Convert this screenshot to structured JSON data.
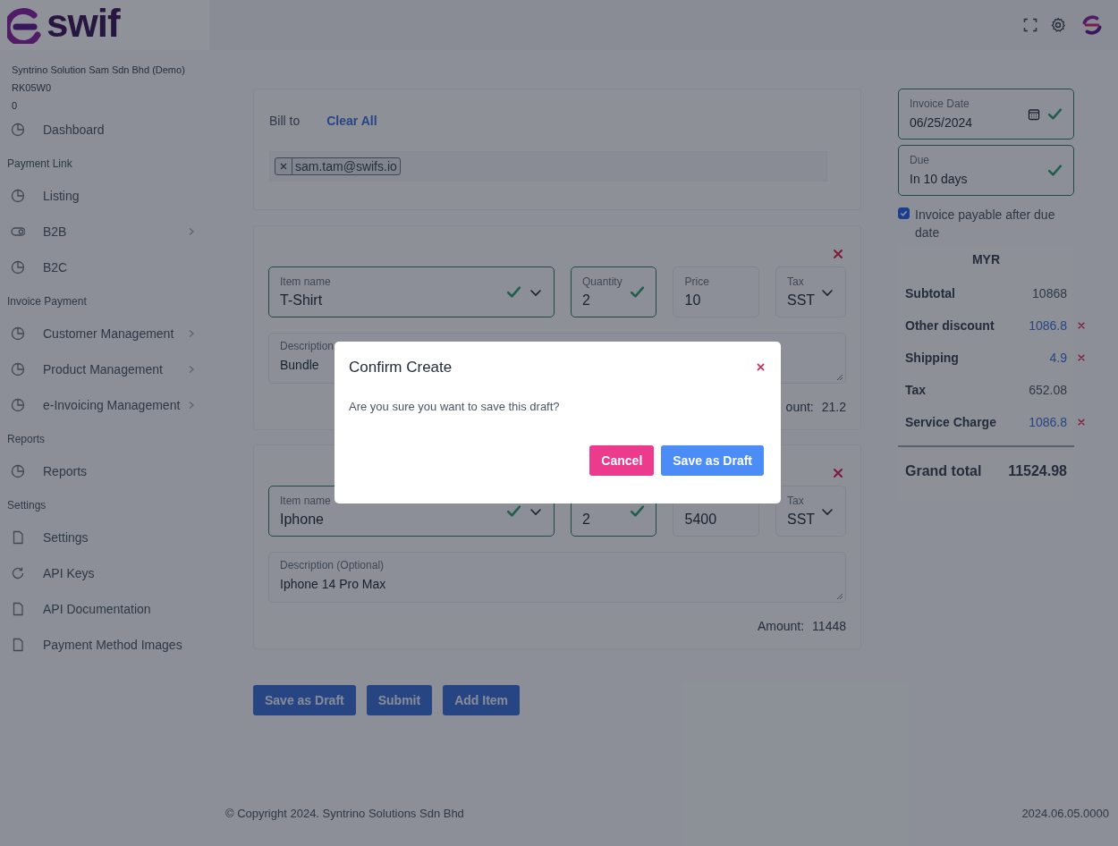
{
  "logo": {
    "text": "swif"
  },
  "account": {
    "company": "Syntrino Solution Sam Sdn Bhd (Demo)",
    "code": "RK05W0",
    "balance": "0"
  },
  "sidebar": {
    "items": [
      {
        "kind": "pie",
        "label": "Dashboard",
        "expandable": false
      },
      {
        "kind": "heading",
        "label": "Payment Link"
      },
      {
        "kind": "pie",
        "label": "Listing",
        "expandable": false
      },
      {
        "kind": "toggle",
        "label": "B2B",
        "expandable": true
      },
      {
        "kind": "pie",
        "label": "B2C",
        "expandable": false
      },
      {
        "kind": "heading",
        "label": "Invoice Payment"
      },
      {
        "kind": "pie",
        "label": "Customer Management",
        "expandable": true
      },
      {
        "kind": "pie",
        "label": "Product Management",
        "expandable": true
      },
      {
        "kind": "pie",
        "label": "e-Invoicing Management",
        "expandable": true
      },
      {
        "kind": "heading",
        "label": "Reports"
      },
      {
        "kind": "pie",
        "label": "Reports",
        "expandable": false
      },
      {
        "kind": "heading",
        "label": "Settings"
      },
      {
        "kind": "file",
        "label": "Settings",
        "expandable": false
      },
      {
        "kind": "refresh",
        "label": "API Keys",
        "expandable": false
      },
      {
        "kind": "file",
        "label": "API Documentation",
        "expandable": false
      },
      {
        "kind": "file",
        "label": "Payment Method Images",
        "expandable": false
      }
    ]
  },
  "bill_to": {
    "label": "Bill to",
    "clear_link": "Clear All",
    "recipients": [
      "sam.tam@swifs.io"
    ]
  },
  "items": [
    {
      "name": {
        "label": "Item name",
        "value": "T-Shirt",
        "valid": true
      },
      "quantity": {
        "label": "Quantity",
        "value": "2",
        "valid": true
      },
      "price": {
        "label": "Price",
        "value": "10",
        "valid": false
      },
      "tax": {
        "label": "Tax",
        "value": "SST"
      },
      "description": {
        "label": "Description",
        "value": "Bundle"
      },
      "amount_label": "ount:",
      "amount": "21.2"
    },
    {
      "name": {
        "label": "Item name",
        "value": "Iphone",
        "valid": true
      },
      "quantity": {
        "value": "2",
        "valid": true
      },
      "price": {
        "value": "5400",
        "valid": false
      },
      "tax": {
        "label": "Tax",
        "value": "SST"
      },
      "description": {
        "label": "Description (Optional)",
        "value": "Iphone 14 Pro Max"
      },
      "amount_label": "Amount:",
      "amount": "11448"
    }
  ],
  "actions": [
    "Save as Draft",
    "Submit",
    "Add Item"
  ],
  "invoice": {
    "date": {
      "label": "Invoice Date",
      "value": "06/25/2024",
      "valid": true
    },
    "due": {
      "label": "Due",
      "value": "In 10 days",
      "valid": true
    },
    "payable_after_due": {
      "label": "Invoice payable after due date",
      "checked": true
    }
  },
  "summary": {
    "currency": "MYR",
    "rows": [
      {
        "label": "Subtotal",
        "value": "10868",
        "editable": false,
        "removable": false
      },
      {
        "label": "Other discount",
        "value": "1086.8",
        "editable": true,
        "removable": true
      },
      {
        "label": "Shipping",
        "value": "4.9",
        "editable": true,
        "removable": true
      },
      {
        "label": "Tax",
        "value": "652.08",
        "editable": false,
        "removable": false
      },
      {
        "label": "Service Charge",
        "value": "1086.8",
        "editable": true,
        "removable": true
      }
    ],
    "grand_total": {
      "label": "Grand total",
      "value": "11524.98"
    }
  },
  "footer": {
    "copyright": "© Copyright 2024. Syntrino Solutions Sdn Bhd",
    "version": "2024.06.05.0000"
  },
  "modal": {
    "title": "Confirm Create",
    "message": "Are you sure you want to save this draft?",
    "buttons": [
      {
        "label": "Cancel",
        "kind": "cancel"
      },
      {
        "label": "Save as Draft",
        "kind": "confirm"
      }
    ]
  }
}
